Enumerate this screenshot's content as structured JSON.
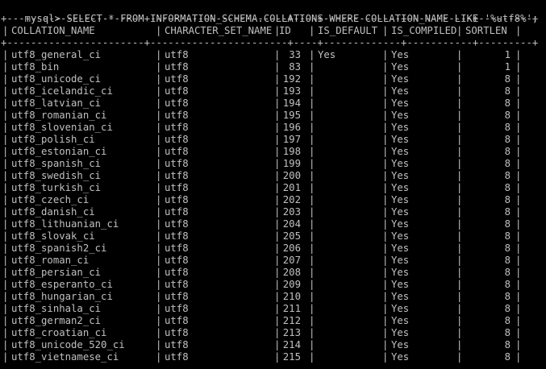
{
  "terminal": {
    "prompt": "mysql>",
    "command": "SELECT * FROM INFORMATION_SCHEMA.COLLATIONS WHERE COLLATION_NAME LIKE '%utf8%';",
    "border": "+-----------------------+-----------------------+----+-------------+-----------+---------+",
    "columns": [
      "COLLATION_NAME",
      "CHARACTER_SET_NAME",
      "ID",
      "IS_DEFAULT",
      "IS_COMPILED",
      "SORTLEN"
    ],
    "rows": [
      [
        "utf8_general_ci",
        "utf8",
        "33",
        "Yes",
        "Yes",
        "1"
      ],
      [
        "utf8_bin",
        "utf8",
        "83",
        "",
        "Yes",
        "1"
      ],
      [
        "utf8_unicode_ci",
        "utf8",
        "192",
        "",
        "Yes",
        "8"
      ],
      [
        "utf8_icelandic_ci",
        "utf8",
        "193",
        "",
        "Yes",
        "8"
      ],
      [
        "utf8_latvian_ci",
        "utf8",
        "194",
        "",
        "Yes",
        "8"
      ],
      [
        "utf8_romanian_ci",
        "utf8",
        "195",
        "",
        "Yes",
        "8"
      ],
      [
        "utf8_slovenian_ci",
        "utf8",
        "196",
        "",
        "Yes",
        "8"
      ],
      [
        "utf8_polish_ci",
        "utf8",
        "197",
        "",
        "Yes",
        "8"
      ],
      [
        "utf8_estonian_ci",
        "utf8",
        "198",
        "",
        "Yes",
        "8"
      ],
      [
        "utf8_spanish_ci",
        "utf8",
        "199",
        "",
        "Yes",
        "8"
      ],
      [
        "utf8_swedish_ci",
        "utf8",
        "200",
        "",
        "Yes",
        "8"
      ],
      [
        "utf8_turkish_ci",
        "utf8",
        "201",
        "",
        "Yes",
        "8"
      ],
      [
        "utf8_czech_ci",
        "utf8",
        "202",
        "",
        "Yes",
        "8"
      ],
      [
        "utf8_danish_ci",
        "utf8",
        "203",
        "",
        "Yes",
        "8"
      ],
      [
        "utf8_lithuanian_ci",
        "utf8",
        "204",
        "",
        "Yes",
        "8"
      ],
      [
        "utf8_slovak_ci",
        "utf8",
        "205",
        "",
        "Yes",
        "8"
      ],
      [
        "utf8_spanish2_ci",
        "utf8",
        "206",
        "",
        "Yes",
        "8"
      ],
      [
        "utf8_roman_ci",
        "utf8",
        "207",
        "",
        "Yes",
        "8"
      ],
      [
        "utf8_persian_ci",
        "utf8",
        "208",
        "",
        "Yes",
        "8"
      ],
      [
        "utf8_esperanto_ci",
        "utf8",
        "209",
        "",
        "Yes",
        "8"
      ],
      [
        "utf8_hungarian_ci",
        "utf8",
        "210",
        "",
        "Yes",
        "8"
      ],
      [
        "utf8_sinhala_ci",
        "utf8",
        "211",
        "",
        "Yes",
        "8"
      ],
      [
        "utf8_german2_ci",
        "utf8",
        "212",
        "",
        "Yes",
        "8"
      ],
      [
        "utf8_croatian_ci",
        "utf8",
        "213",
        "",
        "Yes",
        "8"
      ],
      [
        "utf8_unicode_520_ci",
        "utf8",
        "214",
        "",
        "Yes",
        "8"
      ],
      [
        "utf8_vietnamese_ci",
        "utf8",
        "215",
        "",
        "Yes",
        "8"
      ]
    ]
  },
  "colors": {
    "background": "#000000",
    "foreground": "#c0c0c0"
  }
}
